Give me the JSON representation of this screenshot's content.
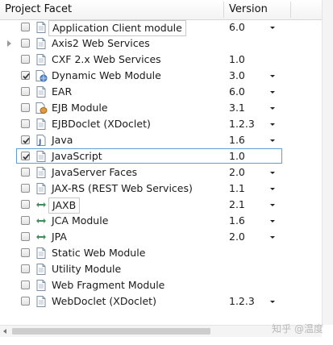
{
  "header": {
    "facet_label": "Project Facet",
    "version_label": "Version"
  },
  "facets": [
    {
      "label": "Application Client module",
      "version": "6.0",
      "checked": false,
      "icon": "file-icon",
      "dropdown": true,
      "expandable": false,
      "boxed": true
    },
    {
      "label": "Axis2 Web Services",
      "version": "",
      "checked": false,
      "icon": "file-icon",
      "dropdown": false,
      "expandable": true
    },
    {
      "label": "CXF 2.x Web Services",
      "version": "1.0",
      "checked": false,
      "icon": "file-icon",
      "dropdown": false,
      "expandable": false
    },
    {
      "label": "Dynamic Web Module",
      "version": "3.0",
      "checked": true,
      "icon": "web-module-icon",
      "dropdown": true,
      "expandable": false
    },
    {
      "label": "EAR",
      "version": "6.0",
      "checked": false,
      "icon": "file-icon",
      "dropdown": true,
      "expandable": false
    },
    {
      "label": "EJB Module",
      "version": "3.1",
      "checked": false,
      "icon": "ejb-icon",
      "dropdown": true,
      "expandable": false
    },
    {
      "label": "EJBDoclet (XDoclet)",
      "version": "1.2.3",
      "checked": false,
      "icon": "file-icon",
      "dropdown": true,
      "expandable": false
    },
    {
      "label": "Java",
      "version": "1.6",
      "checked": true,
      "icon": "java-icon",
      "dropdown": true,
      "expandable": false
    },
    {
      "label": "JavaScript",
      "version": "1.0",
      "checked": true,
      "icon": "file-icon",
      "dropdown": false,
      "expandable": false,
      "selected": true
    },
    {
      "label": "JavaServer Faces",
      "version": "2.0",
      "checked": false,
      "icon": "file-icon",
      "dropdown": true,
      "expandable": false
    },
    {
      "label": "JAX-RS (REST Web Services)",
      "version": "1.1",
      "checked": false,
      "icon": "file-icon",
      "dropdown": true,
      "expandable": false
    },
    {
      "label": "JAXB",
      "version": "2.1",
      "checked": false,
      "icon": "jaxb-icon",
      "dropdown": true,
      "expandable": false,
      "boxed": true
    },
    {
      "label": "JCA Module",
      "version": "1.6",
      "checked": false,
      "icon": "jca-icon",
      "dropdown": true,
      "expandable": false
    },
    {
      "label": "JPA",
      "version": "2.0",
      "checked": false,
      "icon": "jpa-icon",
      "dropdown": true,
      "expandable": false
    },
    {
      "label": "Static Web Module",
      "version": "",
      "checked": false,
      "icon": "file-icon",
      "dropdown": false,
      "expandable": false
    },
    {
      "label": "Utility Module",
      "version": "",
      "checked": false,
      "icon": "file-icon",
      "dropdown": false,
      "expandable": false
    },
    {
      "label": "Web Fragment Module",
      "version": "",
      "checked": false,
      "icon": "file-icon",
      "dropdown": false,
      "expandable": false
    },
    {
      "label": "WebDoclet (XDoclet)",
      "version": "1.2.3",
      "checked": false,
      "icon": "file-icon",
      "dropdown": true,
      "expandable": false
    }
  ],
  "watermark": "知乎 @温度"
}
